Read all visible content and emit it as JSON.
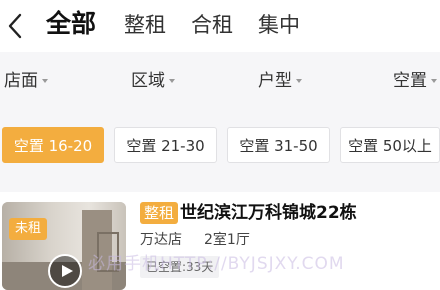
{
  "header": {
    "tabs": [
      {
        "label": "全部",
        "active": true
      },
      {
        "label": "整租",
        "active": false
      },
      {
        "label": "合租",
        "active": false
      },
      {
        "label": "集中",
        "active": false
      }
    ]
  },
  "filters": [
    {
      "label": "店面"
    },
    {
      "label": "区域"
    },
    {
      "label": "户型"
    },
    {
      "label": "空置"
    }
  ],
  "vacancy_chips": [
    {
      "label": "空置 16-20",
      "selected": true
    },
    {
      "label": "空置 21-30",
      "selected": false
    },
    {
      "label": "空置 31-50",
      "selected": false
    },
    {
      "label": "空置 50以上",
      "selected": false
    }
  ],
  "listing": {
    "status_badge": "未租",
    "type_tag": "整租",
    "title": "世纪滨江万科锦城22栋",
    "store": "万达店",
    "layout": "2室1厅",
    "vacancy": "已空置:33天"
  },
  "watermark": "必用手机HTTP://BYJSJXY.COM",
  "colors": {
    "accent": "#f3ad3f",
    "filter_bg": "#f6f6f8"
  }
}
